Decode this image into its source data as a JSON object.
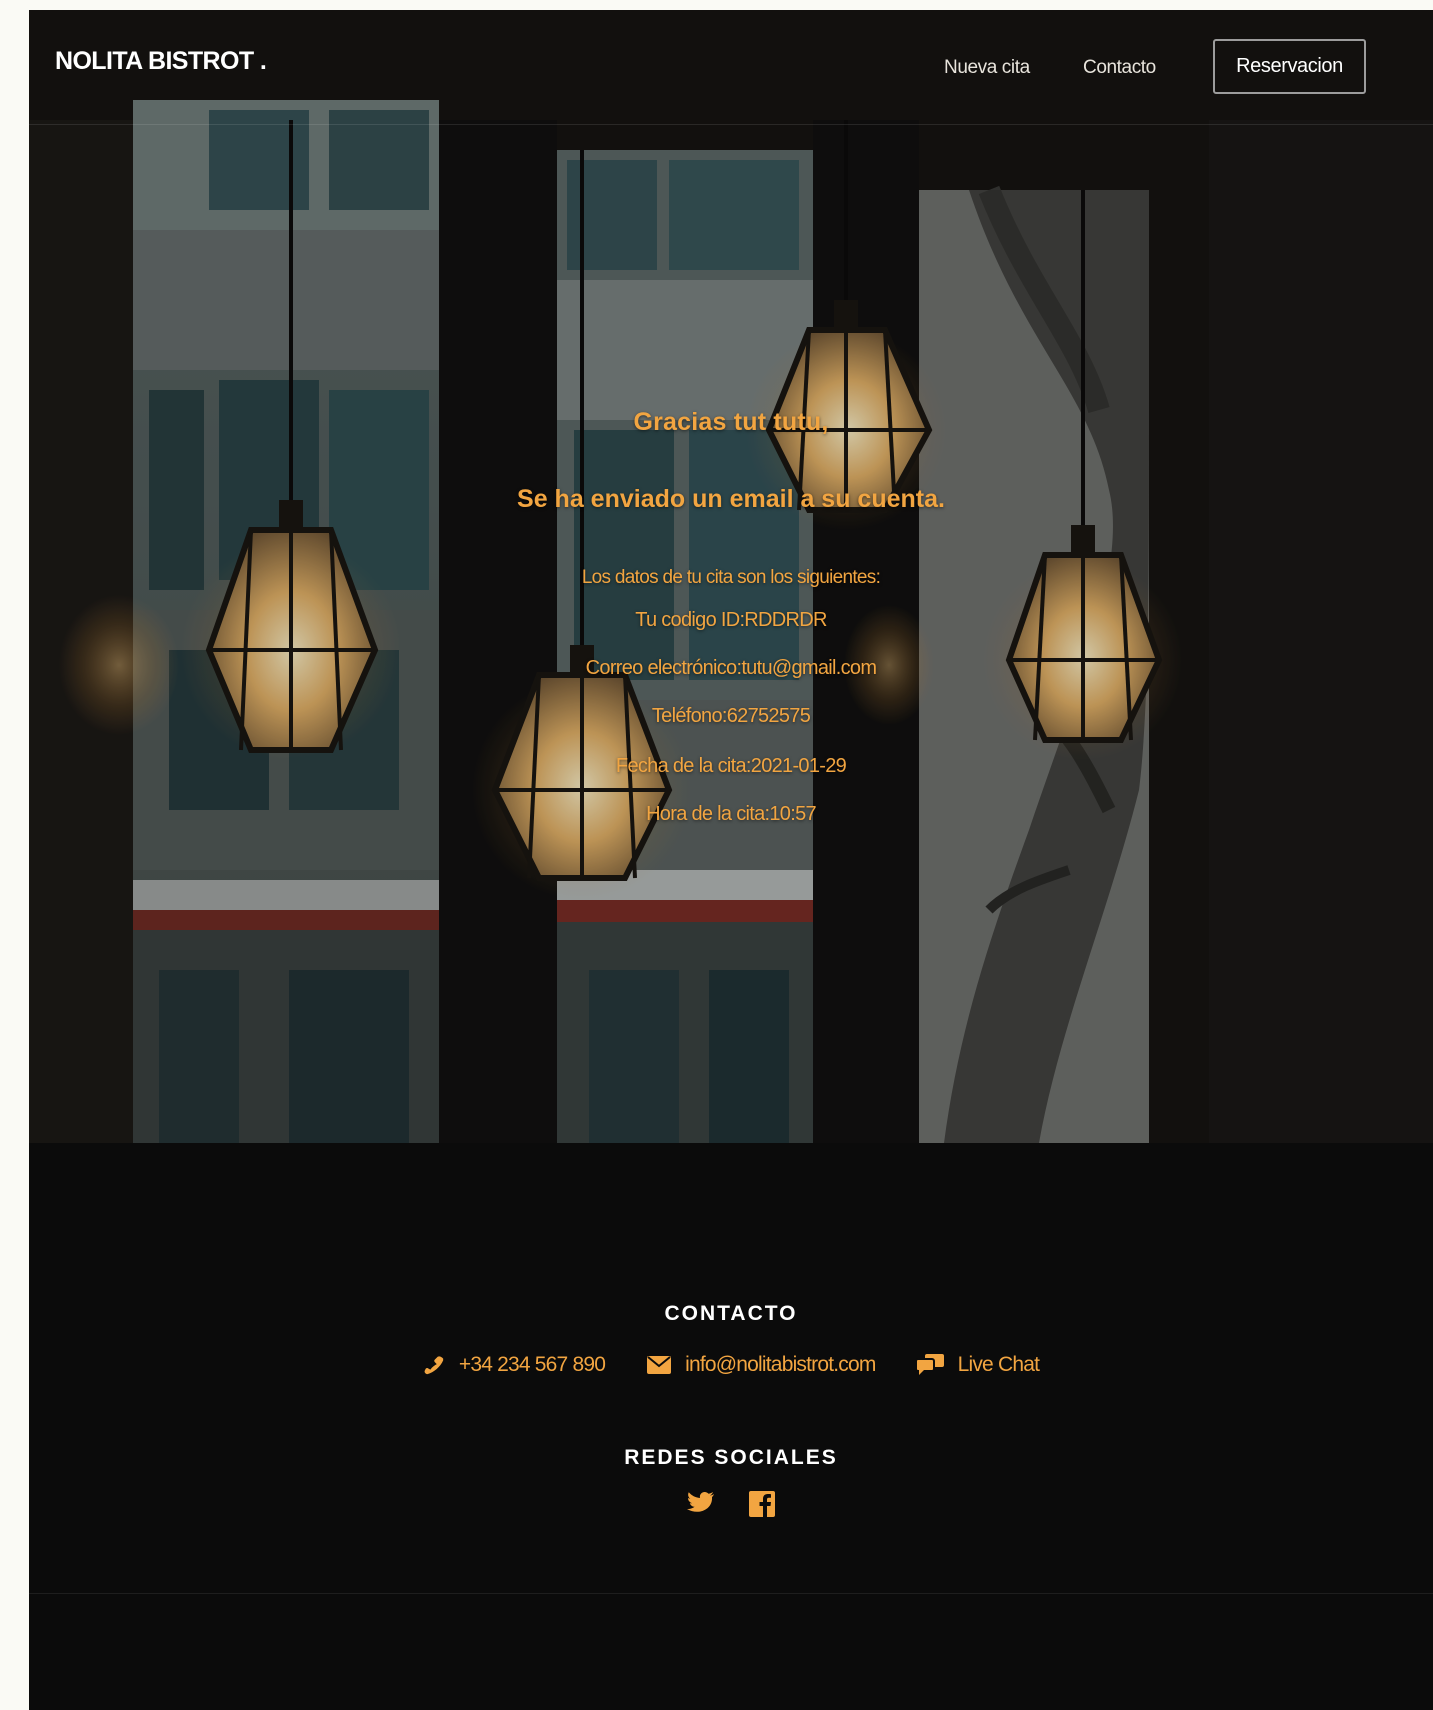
{
  "navbar": {
    "brand": "NOLITA BISTROT .",
    "links": [
      "Nueva cita",
      "Contacto"
    ],
    "cta_label": "Reservacion"
  },
  "confirmation": {
    "greeting": "Gracias tut tutu,",
    "email_sent": "Se ha enviado un email a su cuenta.",
    "intro": "Los datos de tu cita son los siguientes:",
    "id_line": "Tu codigo ID:RDDRDR",
    "mail_line": "Correo electrónico:tutu@gmail.com",
    "phone_line": "Teléfono:62752575",
    "date_line": "Fecha de la cita:2021-01-29",
    "time_line": "Hora de la cita:10:57"
  },
  "footer": {
    "contact_title": "CONTACTO",
    "phone": "+34 234 567 890",
    "email": "info@nolitabistrot.com",
    "chat": "Live Chat",
    "social_title": "REDES SOCIALES",
    "social": [
      {
        "name": "twitter",
        "icon": "twitter-icon"
      },
      {
        "name": "facebook",
        "icon": "facebook-icon"
      }
    ]
  },
  "icons": {
    "phone": "phone-icon",
    "email": "envelope-icon",
    "chat": "chat-bubbles-icon"
  },
  "colors": {
    "accent": "#f2a541",
    "page_bg": "#0b0b0b",
    "outer_bg": "#fafaf5",
    "text_light": "#ffffff"
  }
}
